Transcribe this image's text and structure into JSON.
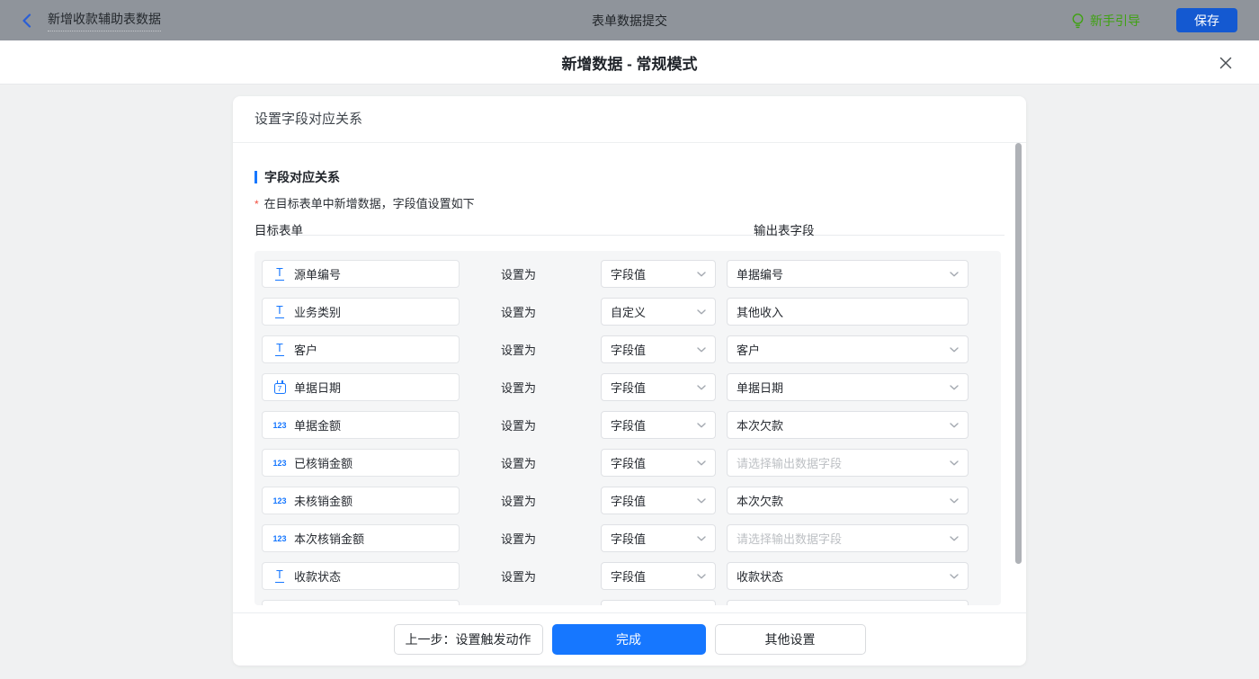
{
  "topbar": {
    "back_icon": "chevron-left",
    "workflow_name": "新增收款辅助表数据",
    "page_title": "表单数据提交",
    "guide": {
      "icon": "lightbulb",
      "label": "新手引导"
    },
    "save_label": "保存"
  },
  "modal": {
    "title": "新增数据 - 常规模式",
    "close_icon": "x"
  },
  "card": {
    "header_title": "设置字段对应关系"
  },
  "section": {
    "title": "字段对应关系",
    "required_mark": "*",
    "hint": "在目标表单中新增数据，字段值设置如下",
    "column_target": "目标表单",
    "column_output": "输出表字段"
  },
  "labels": {
    "set_as": "设置为"
  },
  "icons": {
    "text_glyph": "T",
    "number_glyph": "123",
    "date_glyph": "7",
    "dropdown": "chevron-down"
  },
  "rows": [
    {
      "icon": "text",
      "field": "源单编号",
      "mode": "字段值",
      "output": "单据编号"
    },
    {
      "icon": "text",
      "field": "业务类别",
      "mode": "自定义",
      "output": "其他收入",
      "output_kind": "input"
    },
    {
      "icon": "text",
      "field": "客户",
      "mode": "字段值",
      "output": "客户"
    },
    {
      "icon": "date",
      "field": "单据日期",
      "mode": "字段值",
      "output": "单据日期"
    },
    {
      "icon": "number",
      "field": "单据金额",
      "mode": "字段值",
      "output": "本次欠款"
    },
    {
      "icon": "number",
      "field": "已核销金额",
      "mode": "字段值",
      "output": "",
      "placeholder": "请选择输出数据字段"
    },
    {
      "icon": "number",
      "field": "未核销金额",
      "mode": "字段值",
      "output": "本次欠款"
    },
    {
      "icon": "number",
      "field": "本次核销金额",
      "mode": "字段值",
      "output": "",
      "placeholder": "请选择输出数据字段"
    },
    {
      "icon": "text",
      "field": "收款状态",
      "mode": "字段值",
      "output": "收款状态"
    },
    {
      "partial": true,
      "field": "",
      "mode": "",
      "output": ""
    }
  ],
  "footer": {
    "prev": "上一步：设置触发动作",
    "done": "完成",
    "other": "其他设置"
  },
  "colors": {
    "accent_blue": "#1677ff",
    "topbar_bg": "#8f949b",
    "guide_green": "#3fa211",
    "save_button_blue": "#1459d1",
    "page_bg": "#f0f1f2",
    "panel_bg": "#f5f6f7",
    "scrollbar": "#afb2b7",
    "placeholder_text": "#bdc0c4",
    "required_red": "#f24c3d"
  }
}
